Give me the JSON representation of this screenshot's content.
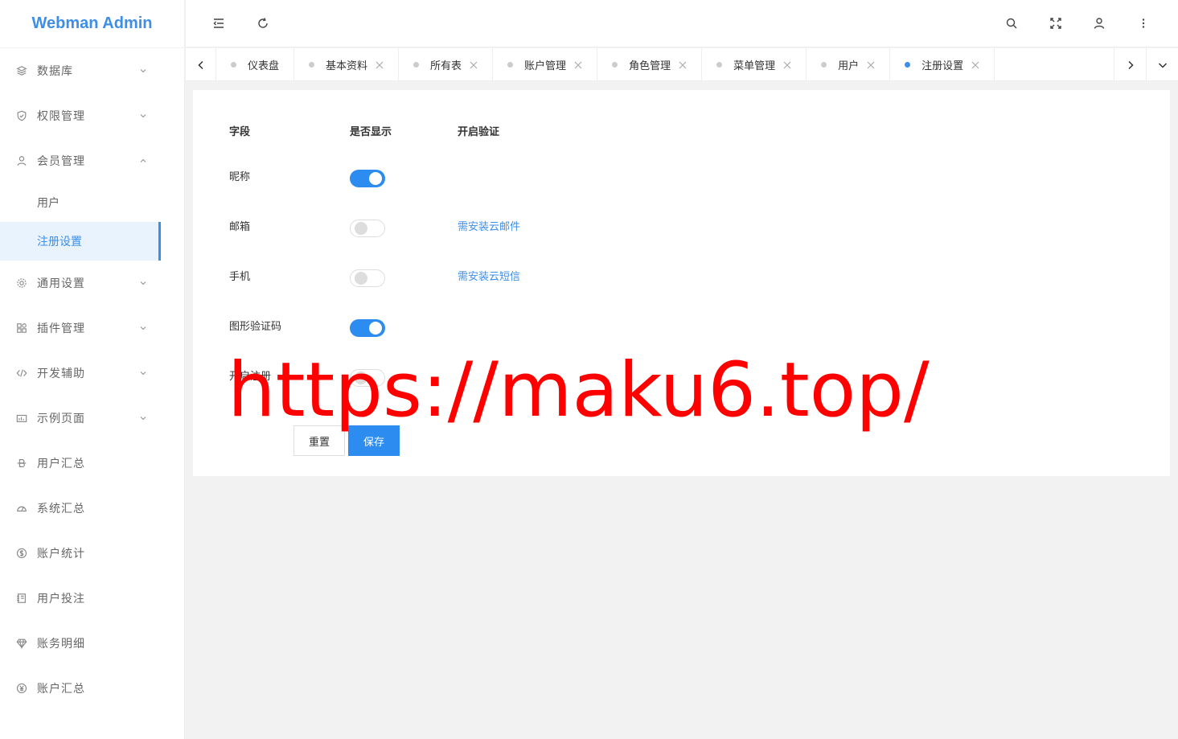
{
  "app": {
    "title": "Webman Admin"
  },
  "sidebar": {
    "items": [
      {
        "label": "数据库",
        "icon": "database-icon",
        "expanded": false
      },
      {
        "label": "权限管理",
        "icon": "shield-icon",
        "expanded": false
      },
      {
        "label": "会员管理",
        "icon": "user-icon",
        "expanded": true,
        "children": [
          {
            "label": "用户"
          },
          {
            "label": "注册设置",
            "active": true
          }
        ]
      },
      {
        "label": "通用设置",
        "icon": "gear-icon",
        "expanded": false
      },
      {
        "label": "插件管理",
        "icon": "apps-icon",
        "expanded": false
      },
      {
        "label": "开发辅助",
        "icon": "code-icon",
        "expanded": false
      },
      {
        "label": "示例页面",
        "icon": "chart-icon",
        "expanded": false
      },
      {
        "label": "用户汇总",
        "icon": "dollar-strike-icon"
      },
      {
        "label": "系统汇总",
        "icon": "gauge-icon"
      },
      {
        "label": "账户统计",
        "icon": "dollar-circle-icon"
      },
      {
        "label": "用户投注",
        "icon": "notebook-icon"
      },
      {
        "label": "账务明细",
        "icon": "diamond-icon"
      },
      {
        "label": "账户汇总",
        "icon": "yen-circle-icon"
      }
    ]
  },
  "header": {
    "icons": [
      "collapse-menu-icon",
      "refresh-icon",
      "search-icon",
      "fullscreen-icon",
      "user-icon",
      "more-icon"
    ]
  },
  "tabs": [
    {
      "label": "仪表盘",
      "closable": false
    },
    {
      "label": "基本资料",
      "closable": true
    },
    {
      "label": "所有表",
      "closable": true
    },
    {
      "label": "账户管理",
      "closable": true
    },
    {
      "label": "角色管理",
      "closable": true
    },
    {
      "label": "菜单管理",
      "closable": true
    },
    {
      "label": "用户",
      "closable": true
    },
    {
      "label": "注册设置",
      "closable": true,
      "active": true
    }
  ],
  "form": {
    "columns": [
      "字段",
      "是否显示",
      "开启验证"
    ],
    "rows": [
      {
        "label": "昵称",
        "enabled": true,
        "verify": ""
      },
      {
        "label": "邮箱",
        "enabled": false,
        "verify": "需安装云邮件"
      },
      {
        "label": "手机",
        "enabled": false,
        "verify": "需安装云短信"
      },
      {
        "label": "图形验证码",
        "enabled": true,
        "verify": ""
      },
      {
        "label": "开启注册",
        "enabled": false,
        "verify": ""
      }
    ],
    "buttons": {
      "reset": "重置",
      "save": "保存"
    }
  },
  "watermark": "https://maku6.top/",
  "colors": {
    "accent": "#3d8ee9",
    "switch_on": "#2d8cf0",
    "watermark": "#ff0000"
  }
}
